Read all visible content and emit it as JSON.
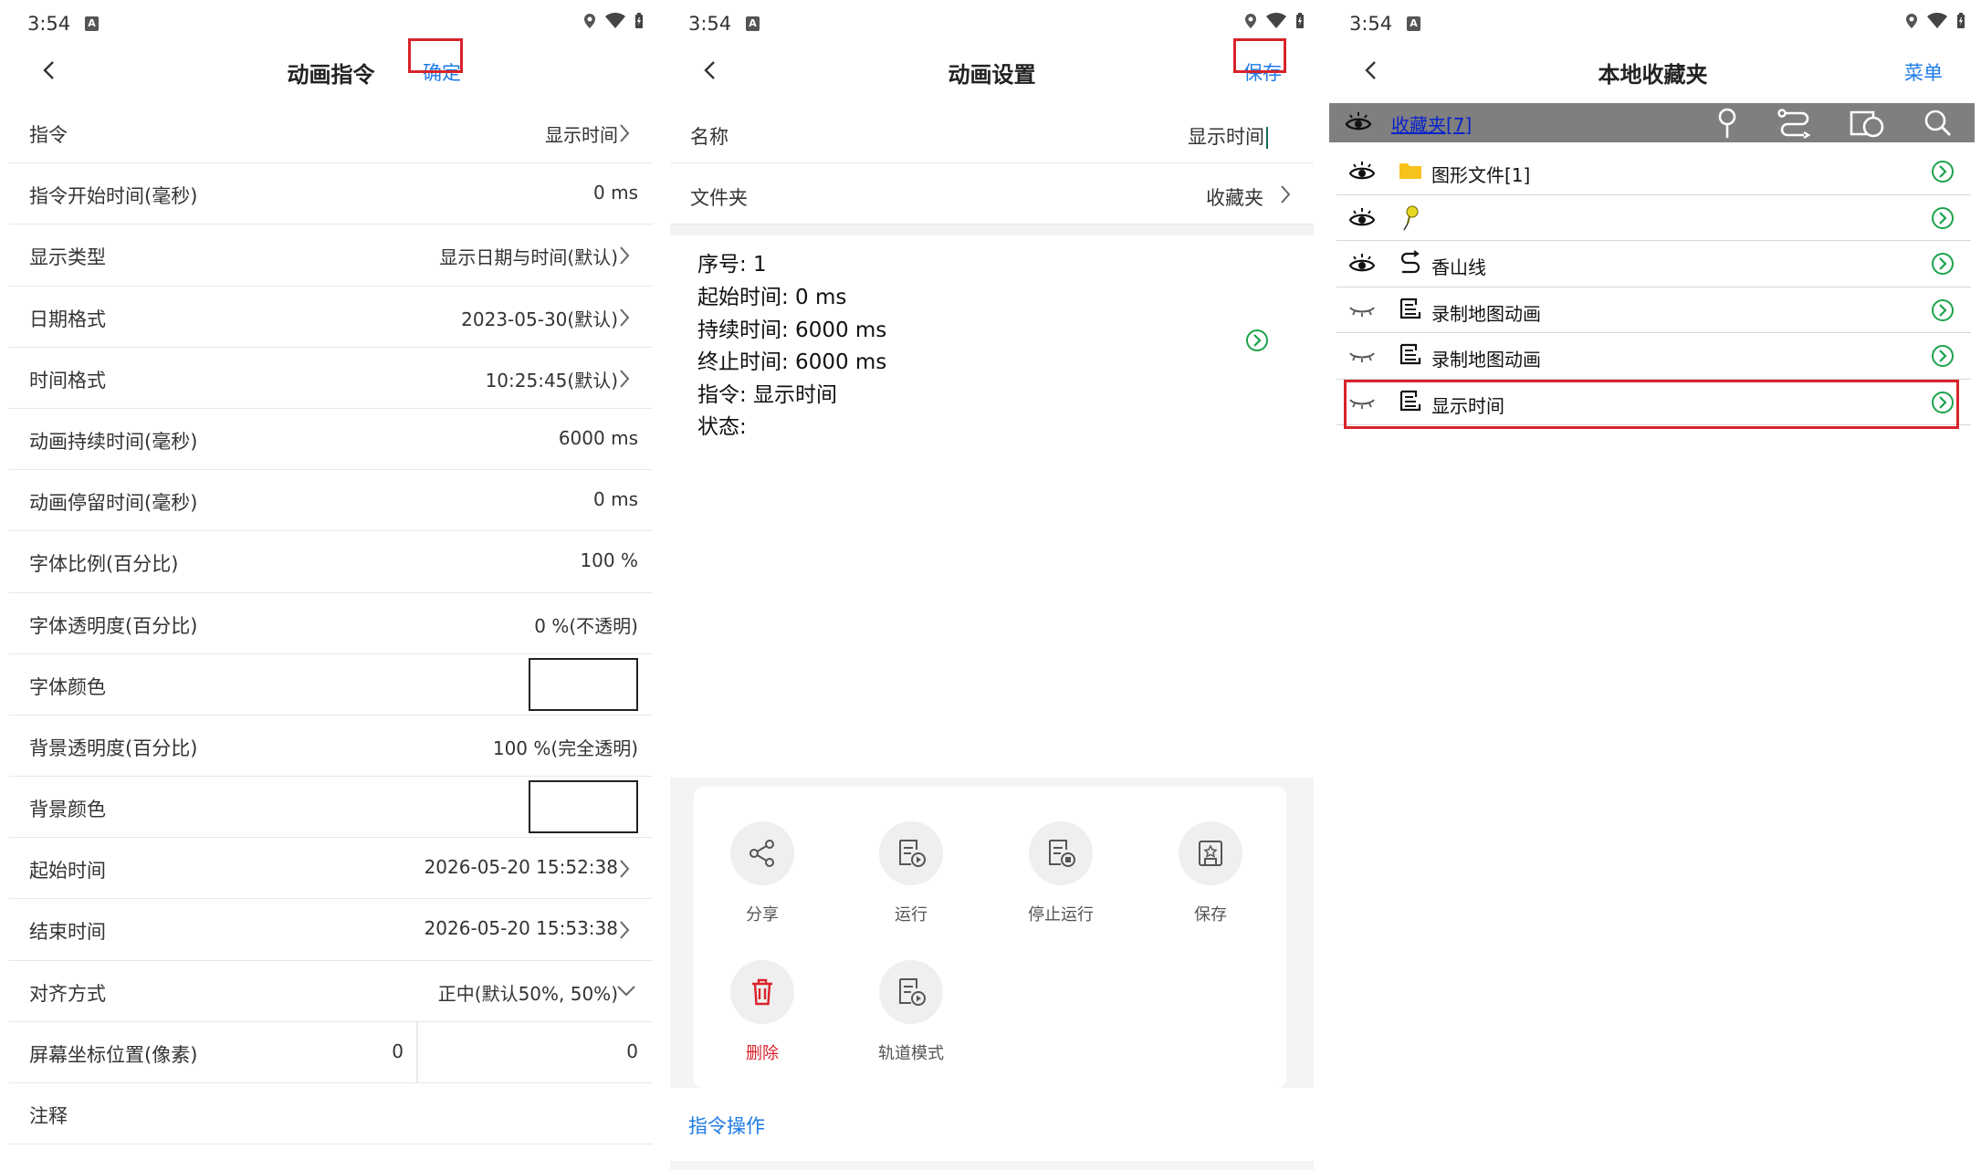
{
  "status": {
    "time": "3:54",
    "sim_badge": "A"
  },
  "panel1": {
    "title": "动画指令",
    "confirm": "确定",
    "rows": [
      {
        "label": "指令",
        "value": "显示时间",
        "chevron": true
      },
      {
        "label": "指令开始时间(毫秒)",
        "value": "0 ms"
      },
      {
        "label": "显示类型",
        "value": "显示日期与时间(默认)",
        "chevron": true
      },
      {
        "label": "日期格式",
        "value": "2023-05-30(默认)",
        "chevron": true
      },
      {
        "label": "时间格式",
        "value": "10:25:45(默认)",
        "chevron": true
      },
      {
        "label": "动画持续时间(毫秒)",
        "value": "6000 ms"
      },
      {
        "label": "动画停留时间(毫秒)",
        "value": "0 ms"
      },
      {
        "label": "字体比例(百分比)",
        "value": "100 %"
      },
      {
        "label": "字体透明度(百分比)",
        "value": "0 %(不透明)"
      },
      {
        "label": "字体颜色",
        "swatch": true
      },
      {
        "label": "背景透明度(百分比)",
        "value": "100 %(完全透明)"
      },
      {
        "label": "背景颜色",
        "swatch": true
      },
      {
        "label": "起始时间",
        "value": "2026-05-20 15:52:38",
        "chevron": true
      },
      {
        "label": "结束时间",
        "value": "2026-05-20 15:53:38",
        "chevron": true
      },
      {
        "label": "对齐方式",
        "value": "正中(默认50%, 50%)",
        "dropdown": true
      },
      {
        "label": "屏幕坐标位置(像素)",
        "value_x": "0",
        "value_y": "0"
      },
      {
        "label": "注释",
        "value": ""
      }
    ]
  },
  "panel2": {
    "title": "动画设置",
    "save": "保存",
    "name_label": "名称",
    "name_value": "显示时间",
    "folder_label": "文件夹",
    "folder_value": "收藏夹",
    "info_lines": [
      "序号: 1",
      "起始时间: 0 ms",
      "持续时间: 6000 ms",
      "终止时间: 6000 ms",
      "指令: 显示时间",
      "状态:"
    ],
    "operations": [
      {
        "label": "分享",
        "icon": "share-icon"
      },
      {
        "label": "运行",
        "icon": "run-icon"
      },
      {
        "label": "停止运行",
        "icon": "stop-run-icon"
      },
      {
        "label": "保存",
        "icon": "save-icon"
      },
      {
        "label": "删除",
        "icon": "trash-icon"
      },
      {
        "label": "轨道模式",
        "icon": "track-mode-icon"
      }
    ],
    "footer": "指令操作"
  },
  "panel3": {
    "title": "本地收藏夹",
    "menu": "菜单",
    "folder_link": "收藏夹[7]",
    "items": [
      {
        "name": "图形文件[1]",
        "icon": "folder-icon",
        "visible": true
      },
      {
        "name": "",
        "icon": "pushpin-icon",
        "visible": true
      },
      {
        "name": "香山线",
        "icon": "route-icon",
        "visible": true
      },
      {
        "name": "录制地图动画",
        "icon": "animation-file-icon",
        "visible": false
      },
      {
        "name": "录制地图动画",
        "icon": "animation-file-icon",
        "visible": false
      },
      {
        "name": "显示时间",
        "icon": "animation-file-icon",
        "visible": false
      }
    ]
  },
  "colors": {
    "accent": "#1e7be6",
    "highlight": "#d8232a",
    "go_green": "#1aa34a",
    "toolbar_gray": "#7f7f7f"
  }
}
